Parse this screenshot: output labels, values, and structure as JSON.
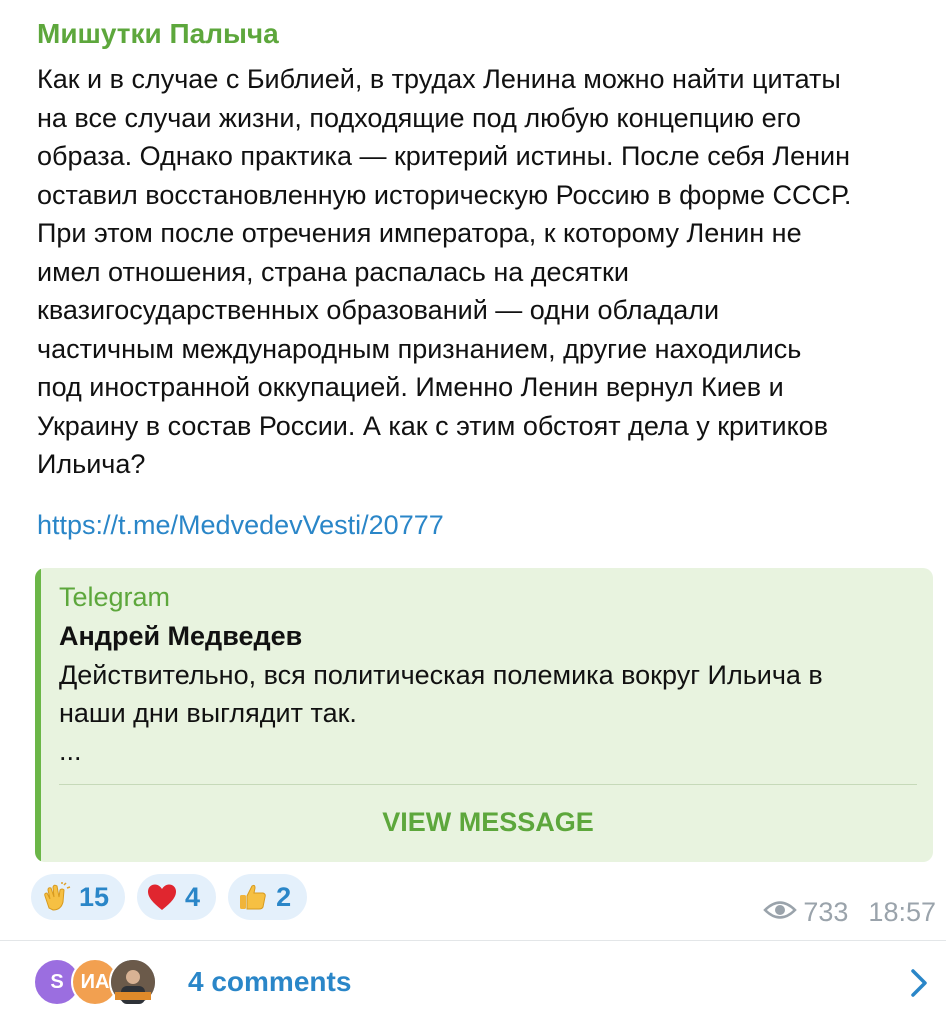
{
  "post": {
    "channel_name": "Мишутки Палыча",
    "text": "Как и в случае с Библией, в трудах Ленина можно найти цитаты\nна все случаи жизни, подходящие под любую концепцию его\nобраза. Однако практика — критерий истины. После себя Ленин\nоставил восстановленную историческую Россию в форме СССР.\nПри этом после отречения императора, к которому Ленин не\nимел отношения, страна распалась на десятки\nквазигосударственных образований — одни обладали\nчастичным международным признанием, другие находились\nпод иностранной оккупацией. Именно Ленин вернул Киев и\nУкраину в состав России. А как с этим обстоят дела у критиков\nИльича?",
    "link": "https://t.me/MedvedevVesti/20777"
  },
  "preview": {
    "site": "Telegram",
    "title": "Андрей Медведев",
    "description": "Действительно, вся политическая полемика вокруг Ильича в\nнаши дни выглядит так.\n...",
    "button": "VIEW MESSAGE"
  },
  "reactions": [
    {
      "emoji": "clapping-hands-icon",
      "count": "15"
    },
    {
      "emoji": "red-heart-icon",
      "count": "4"
    },
    {
      "emoji": "thumbs-up-icon",
      "count": "2"
    }
  ],
  "meta": {
    "views": "733",
    "time": "18:57"
  },
  "comments": {
    "avatars": [
      {
        "initials": "S",
        "color": "#9b6ee0"
      },
      {
        "initials": "ИА",
        "color": "#f2a050"
      },
      {
        "initials": "",
        "color": "#5a6470"
      }
    ],
    "label": "4 comments"
  }
}
